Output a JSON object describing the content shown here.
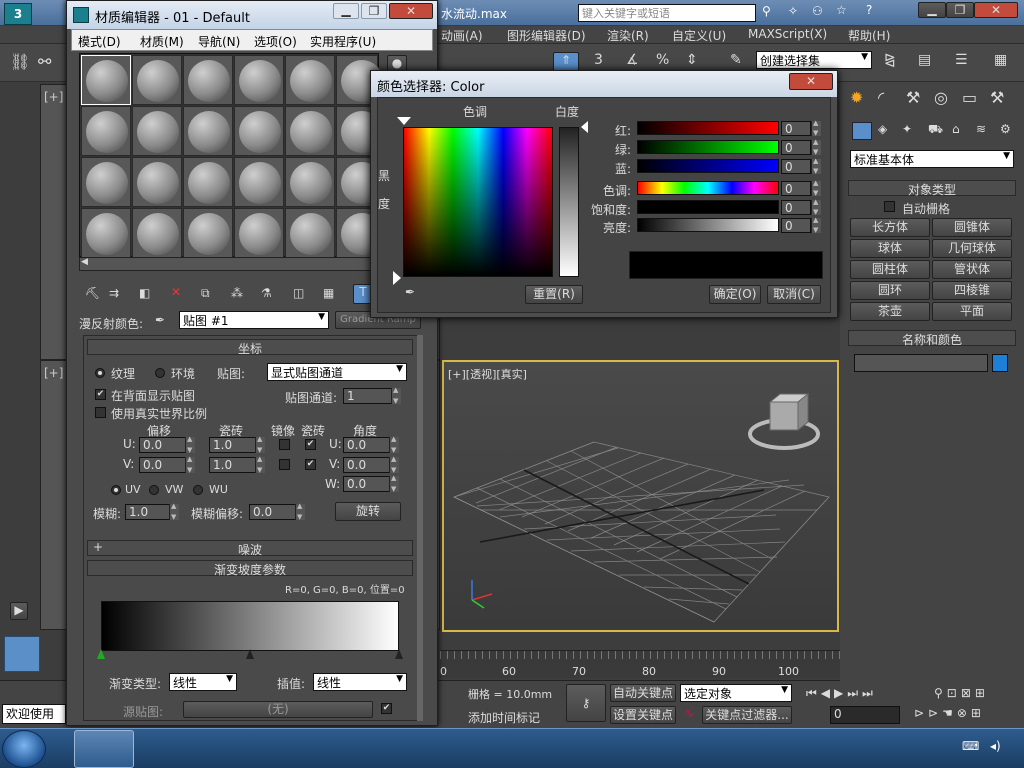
{
  "app": {
    "title_file": "水流动.max",
    "search_placeholder": "键入关键字或短语",
    "menu": [
      "动画(A)",
      "图形编辑器(D)",
      "渲染(R)",
      "自定义(U)",
      "MAXScript(X)",
      "帮助(H)"
    ],
    "selection_set": "创建选择集",
    "toolbar_number": "3",
    "toolbar_percent": "%"
  },
  "viewports": {
    "top_left_label": "[+]",
    "mid_left_label": "[+]",
    "perspective_label": "[+][透视][真实]"
  },
  "command_panel": {
    "category": "标准基本体",
    "object_type_title": "对象类型",
    "auto_grid": "自动栅格",
    "buttons": [
      "长方体",
      "圆锥体",
      "球体",
      "几何球体",
      "圆柱体",
      "管状体",
      "圆环",
      "四棱锥",
      "茶壶",
      "平面"
    ],
    "name_color_title": "名称和颜色",
    "name_value": "",
    "object_color": "#1e7fd6"
  },
  "material_editor": {
    "title": "材质编辑器 - 01 - Default",
    "menu": [
      "模式(D)",
      "材质(M)",
      "导航(N)",
      "选项(O)",
      "实用程序(U)"
    ],
    "diffuse_label": "漫反射颜色:",
    "map_name": "贴图 #1",
    "map_type": "Gradient Ramp",
    "coords": {
      "title": "坐标",
      "texture": "纹理",
      "environ": "环境",
      "map_label": "贴图:",
      "map_value": "显式贴图通道",
      "show_back": "在背面显示贴图",
      "real_world": "使用真实世界比例",
      "channel_label": "贴图通道:",
      "channel_value": "1",
      "offset": "偏移",
      "tiling": "瓷砖",
      "mirror": "镜像",
      "tile": "瓷砖",
      "angle": "角度",
      "u_label": "U:",
      "v_label": "V:",
      "w_label": "W:",
      "u_offset": "0.0",
      "v_offset": "0.0",
      "u_tiling": "1.0",
      "v_tiling": "1.0",
      "u_angle": "0.0",
      "v_angle": "0.0",
      "w_angle": "0.0",
      "uv": "UV",
      "vw": "VW",
      "wu": "WU",
      "blur_label": "模糊:",
      "blur_value": "1.0",
      "blur_offset_label": "模糊偏移:",
      "blur_offset_value": "0.0",
      "rotate": "旋转"
    },
    "noise_title": "噪波",
    "gradient": {
      "title": "渐变坡度参数",
      "info": "R=0, G=0, B=0,  位置=0",
      "type_label": "渐变类型:",
      "type_value": "线性",
      "interp_label": "插值:",
      "interp_value": "线性",
      "source_label": "源贴图:",
      "source_value": "(无)"
    }
  },
  "color_picker": {
    "title": "颜色选择器: Color",
    "hue_label": "色调",
    "white_label": "白度",
    "black_label_1": "黑",
    "black_label_2": "度",
    "red_label": "红:",
    "green_label": "绿:",
    "blue_label": "蓝:",
    "hue2_label": "色调:",
    "sat_label": "饱和度:",
    "val_label": "亮度:",
    "red": "0",
    "green": "0",
    "blue": "0",
    "hue": "0",
    "sat": "0",
    "val": "0",
    "reset": "重置(R)",
    "ok": "确定(O)",
    "cancel": "取消(C)",
    "swatch": "#000000"
  },
  "bottom": {
    "grid": "栅格 = 10.0mm",
    "auto_key": "自动关键点",
    "selected": "选定对象",
    "set_key": "设置关键点",
    "key_filter": "关键点过滤器...",
    "add_time_tag": "添加时间标记",
    "frame": "0",
    "ruler": [
      "60",
      "70",
      "80",
      "90",
      "100"
    ],
    "ruler_start": "0",
    "welcome": "欢迎使用"
  }
}
